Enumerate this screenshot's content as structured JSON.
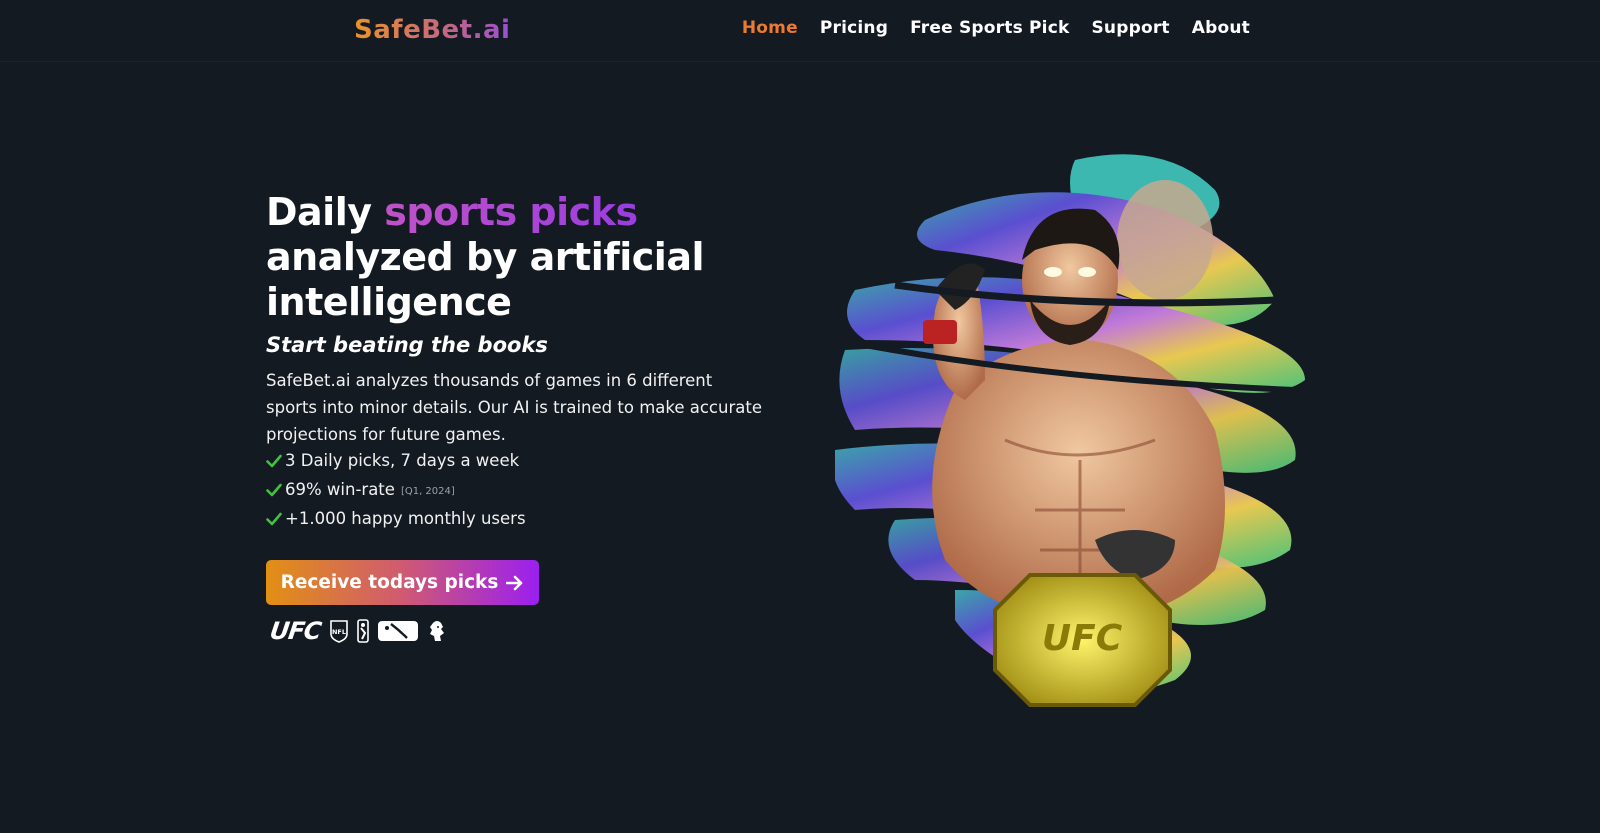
{
  "header": {
    "logo": "SafeBet.ai",
    "nav": [
      {
        "label": "Home",
        "active": true
      },
      {
        "label": "Pricing"
      },
      {
        "label": "Free Sports Pick"
      },
      {
        "label": "Support"
      },
      {
        "label": "About"
      }
    ]
  },
  "hero": {
    "title_start": "Daily ",
    "title_accent": "sports picks",
    "title_end": "analyzed by artificial intelligence",
    "subtitle": "Start beating the books",
    "description": "SafeBet.ai analyzes thousands of games in 6 different sports into minor details. Our AI is trained to make accurate projections for future games.",
    "features": [
      {
        "text": "3 Daily picks, 7 days a week"
      },
      {
        "text": "69% win-rate",
        "note": "[Q1, 2024]"
      },
      {
        "text": "+1.000 happy monthly users"
      }
    ],
    "cta": "Receive todays picks",
    "league_logos": {
      "ufc": "UFC",
      "nfl": "NFL",
      "nba": "nba-logo-icon",
      "mlb": "mlb-logo-icon",
      "premier_league": "premier-league-lion-icon"
    }
  },
  "art": {
    "belt_text": "UFC"
  },
  "colors": {
    "background": "#131a21",
    "nav_active": "#ef7a2d",
    "accent_purple": "#9a3de0",
    "check_green": "#3fc33f"
  }
}
